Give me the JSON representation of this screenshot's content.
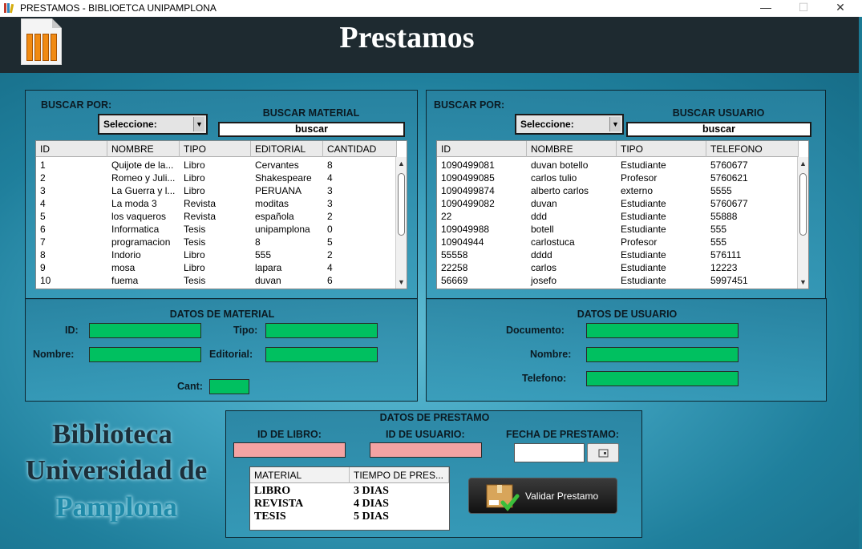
{
  "window": {
    "title": "PRESTAMOS - BIBLIOETCA UNIPAMPLONA",
    "controls": {
      "minimize": "—",
      "maximize": "☐",
      "close": "✕"
    }
  },
  "header": {
    "title": "Prestamos"
  },
  "material_search": {
    "buscar_por": "BUSCAR POR:",
    "select_value": "Seleccione:",
    "section_title": "BUSCAR MATERIAL",
    "search_value": "buscar",
    "columns": [
      "ID",
      "NOMBRE",
      "TIPO",
      "EDITORIAL",
      "CANTIDAD"
    ],
    "rows": [
      [
        "1",
        "Quijote de la...",
        "Libro",
        "Cervantes",
        "8"
      ],
      [
        "2",
        "Romeo y Juli...",
        "Libro",
        "Shakespeare",
        "4"
      ],
      [
        "3",
        "La Guerra y l...",
        "Libro",
        "PERUANA",
        "3"
      ],
      [
        "4",
        "La moda 3",
        "Revista",
        "moditas",
        "3"
      ],
      [
        "5",
        "los vaqueros",
        "Revista",
        "española",
        "2"
      ],
      [
        "6",
        "Informatica",
        "Tesis",
        "unipamplona",
        "0"
      ],
      [
        "7",
        "programacion",
        "Tesis",
        "8",
        "5"
      ],
      [
        "8",
        "Indorio",
        "Libro",
        "555",
        "2"
      ],
      [
        "9",
        "mosa",
        "Libro",
        "lapara",
        "4"
      ],
      [
        "10",
        "fuema",
        "Tesis",
        "duvan",
        "6"
      ]
    ]
  },
  "user_search": {
    "buscar_por": "BUSCAR POR:",
    "select_value": "Seleccione:",
    "section_title": "BUSCAR USUARIO",
    "search_value": "buscar",
    "columns": [
      "ID",
      "NOMBRE",
      "TIPO",
      "TELEFONO"
    ],
    "rows": [
      [
        "1090499081",
        "duvan botello",
        "Estudiante",
        "5760677"
      ],
      [
        "1090499085",
        "carlos tulio",
        "Profesor",
        "5760621"
      ],
      [
        "1090499874",
        "alberto carlos",
        "externo",
        "5555"
      ],
      [
        "1090499082",
        "duvan",
        "Estudiante",
        "5760677"
      ],
      [
        "22",
        "ddd",
        "Estudiante",
        "55888"
      ],
      [
        "109049988",
        "botell",
        "Estudiante",
        "555"
      ],
      [
        "10904944",
        "carlostuca",
        "Profesor",
        "555"
      ],
      [
        "55558",
        "dddd",
        "Estudiante",
        "576111"
      ],
      [
        "22258",
        "carlos",
        "Estudiante",
        "12223"
      ],
      [
        "56669",
        "josefo",
        "Estudiante",
        "5997451"
      ]
    ]
  },
  "material_data": {
    "title": "DATOS DE MATERIAL",
    "id_label": "ID:",
    "tipo_label": "Tipo:",
    "nombre_label": "Nombre:",
    "editorial_label": "Editorial:",
    "cant_label": "Cant:"
  },
  "user_data": {
    "title": "DATOS DE USUARIO",
    "documento_label": "Documento:",
    "nombre_label": "Nombre:",
    "telefono_label": "Telefono:"
  },
  "branding": {
    "line1": "Biblioteca",
    "line2": "Universidad de",
    "line3": "Pamplona"
  },
  "loan": {
    "title": "DATOS DE PRESTAMO",
    "id_libro_label": "ID DE LIBRO:",
    "id_usuario_label": "ID DE USUARIO:",
    "fecha_label": "FECHA DE PRESTAMO:",
    "table_columns": [
      "MATERIAL",
      "TIEMPO DE PRES..."
    ],
    "table_rows": [
      [
        "LIBRO",
        "3 DIAS"
      ],
      [
        "REVISTA",
        "4 DIAS"
      ],
      [
        "TESIS",
        "5 DIAS"
      ]
    ],
    "validate_button": "Validar Prestamo"
  },
  "colors": {
    "green_field": "#00c060",
    "pink_field": "#f4a3a3",
    "header_bg": "#1e2a30"
  }
}
